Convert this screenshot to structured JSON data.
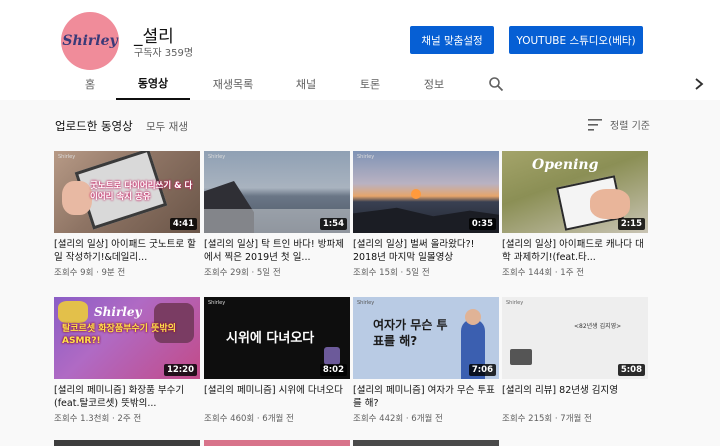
{
  "channel": {
    "avatar_text": "Shirley",
    "name": "_셜리",
    "subscribers": "구독자 359명"
  },
  "buttons": {
    "customize": "채널 맞춤설정",
    "studio": "YOUTUBE 스튜디오(베타)"
  },
  "tabs": [
    "홈",
    "동영상",
    "재생목록",
    "채널",
    "토론",
    "정보"
  ],
  "active_tab": "동영상",
  "section": {
    "title": "업로드한 동영상",
    "play_all": "모두 재생",
    "sort": "정렬 기준"
  },
  "videos": [
    {
      "title": "[셜리의 일상] 아이패드 굿노트로 할일 작성하기!&데일리...",
      "meta": "조회수 9회 · 9분 전",
      "duration": "4:41",
      "thumb_text": "굿노트로 다이어리쓰기 & 다이어리 속지 공유"
    },
    {
      "title": "[셜리의 일상] 탁 트인 바다! 방파제에서 찍은 2019년 첫 일...",
      "meta": "조회수 29회 · 5일 전",
      "duration": "1:54",
      "thumb_text": ""
    },
    {
      "title": "[셜리의 일상] 벌써 올라왔다?! 2018년 마지막 일몰영상",
      "meta": "조회수 15회 · 5일 전",
      "duration": "0:35",
      "thumb_text": ""
    },
    {
      "title": "[셜리의 일상] 아이패드로 캐나다 대학 과제하기!(feat.타...",
      "meta": "조회수 144회 · 1주 전",
      "duration": "2:15",
      "thumb_text": "Opening"
    },
    {
      "title": "[셜리의 페미니즘] 화장품 부수기(feat.탈코르셋) 뜻밖의...",
      "meta": "조회수 1.3천회 · 2주 전",
      "duration": "12:20",
      "thumb_text": "탈코르셋 화장품부수기 뜻밖의 ASMR?!"
    },
    {
      "title": "[셜리의 페미니즘] 시위에 다녀오다",
      "meta": "조회수 460회 · 6개월 전",
      "duration": "8:02",
      "thumb_text": "시위에 다녀오다"
    },
    {
      "title": "[셜리의 페미니즘] 여자가 무슨 투표를 해?",
      "meta": "조회수 442회 · 6개월 전",
      "duration": "7:06",
      "thumb_text": "여자가 무슨 투표를 해?"
    },
    {
      "title": "[셜리의 리뷰] 82년생 김지영",
      "meta": "조회수 215회 · 7개월 전",
      "duration": "5:08",
      "thumb_text": "<82년생 김지영>"
    }
  ],
  "thumb_watermark": "Shirley",
  "colors": {
    "primary_button": "#065fd4",
    "avatar_bg": "#f08c9a"
  }
}
